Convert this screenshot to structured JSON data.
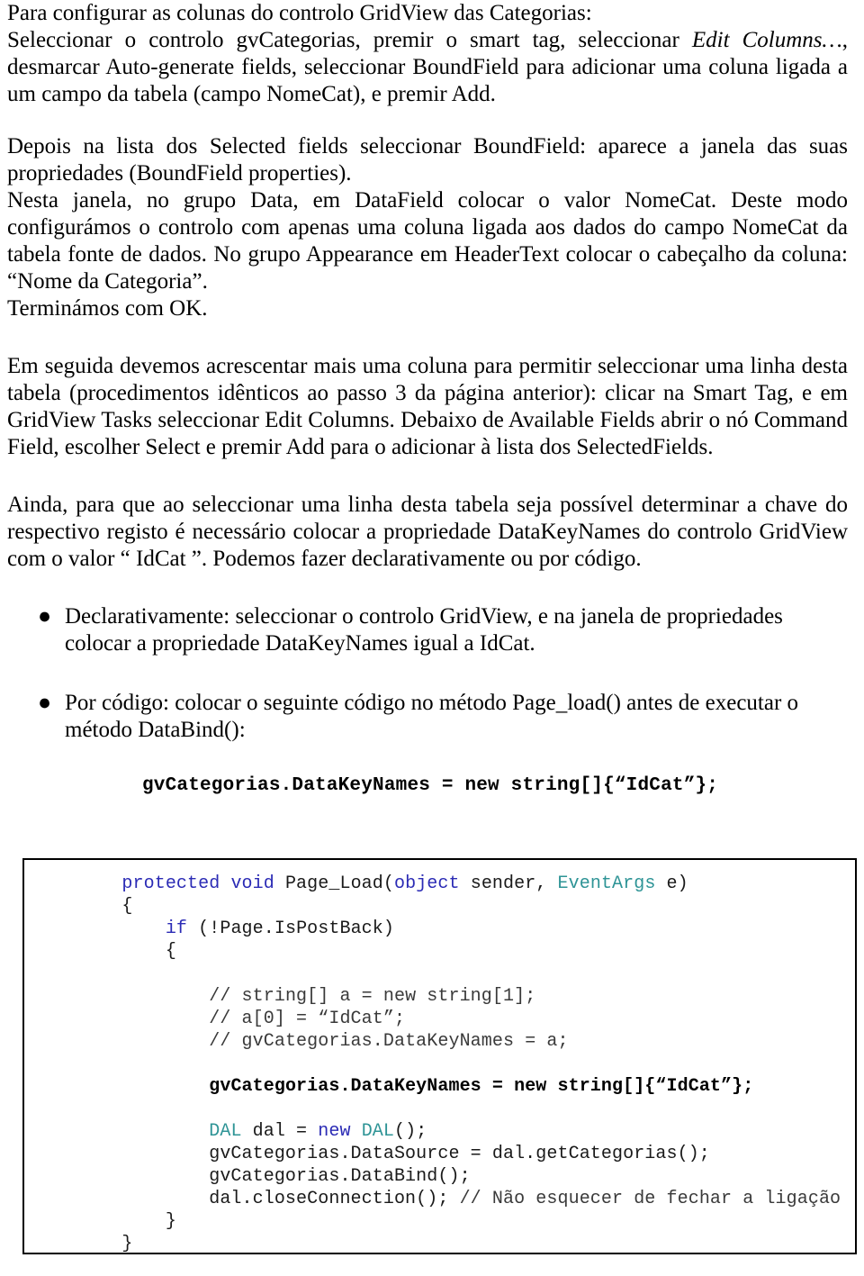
{
  "document": {
    "intro": {
      "line1": "Para configurar as colunas do controlo GridView das Categorias:",
      "line2_pre": "Seleccionar o controlo gvCategorias, premir o smart tag, seleccionar ",
      "line2_italic": "Edit Columns…",
      "line2_post": ", desmarcar Auto-generate fields, seleccionar BoundField para adicionar uma coluna ligada a um campo da tabela (campo NomeCat), e premir Add."
    },
    "paragraphs": {
      "p1": "Depois na lista dos Selected fields seleccionar BoundField: aparece a janela das suas propriedades (BoundField properties).",
      "p2": "Nesta janela, no grupo Data, em DataField colocar o valor NomeCat. Deste modo configurámos o controlo com apenas uma coluna ligada aos dados do campo NomeCat da tabela fonte de dados. No grupo Appearance em HeaderText colocar o cabeçalho da coluna: “Nome da Categoria”.",
      "p3": "Terminámos com OK.",
      "p4": "Em seguida devemos acrescentar mais uma coluna para permitir seleccionar uma linha desta tabela (procedimentos idênticos ao passo 3 da página anterior): clicar na Smart Tag, e em GridView Tasks seleccionar Edit Columns. Debaixo de Available Fields abrir o nó Command Field, escolher Select e premir Add para o adicionar à lista dos SelectedFields.",
      "p5": "Ainda, para que ao seleccionar uma linha desta tabela seja possível determinar a chave do respectivo registo é necessário colocar a propriedade DataKeyNames do controlo GridView com o valor “ IdCat ”. Podemos fazer declarativamente ou por código."
    },
    "bullets": [
      {
        "marker": "●",
        "text": "Declarativamente: seleccionar o controlo GridView, e na janela de propriedades colocar a propriedade DataKeyNames igual a IdCat."
      },
      {
        "marker": "●",
        "text": "Por código: colocar o seguinte código no método Page_load() antes de executar o método DataBind():"
      }
    ],
    "code_snippet_line": "gvCategorias.DataKeyNames = new string[]{“IdCat”};",
    "code_block": {
      "lines": [
        {
          "segments": [
            {
              "t": "    ",
              "c": ""
            },
            {
              "t": "protected void ",
              "c": "kw"
            },
            {
              "t": "Page_Load(",
              "c": ""
            },
            {
              "t": "object",
              "c": "kw"
            },
            {
              "t": " sender, ",
              "c": ""
            },
            {
              "t": "EventArgs",
              "c": "typ"
            },
            {
              "t": " e)",
              "c": ""
            }
          ]
        },
        {
          "segments": [
            {
              "t": "    {",
              "c": ""
            }
          ]
        },
        {
          "segments": [
            {
              "t": "        ",
              "c": ""
            },
            {
              "t": "if",
              "c": "kw"
            },
            {
              "t": " (!Page.IsPostBack)",
              "c": ""
            }
          ]
        },
        {
          "segments": [
            {
              "t": "        {",
              "c": ""
            }
          ]
        },
        {
          "segments": [
            {
              "t": "",
              "c": ""
            }
          ]
        },
        {
          "segments": [
            {
              "t": "            ",
              "c": ""
            },
            {
              "t": "// string[] a = new string[1];",
              "c": "cmt"
            }
          ]
        },
        {
          "segments": [
            {
              "t": "            ",
              "c": ""
            },
            {
              "t": "// a[0] = “IdCat”;",
              "c": "cmt"
            }
          ]
        },
        {
          "segments": [
            {
              "t": "            ",
              "c": ""
            },
            {
              "t": "// gvCategorias.DataKeyNames = a;",
              "c": "cmt"
            }
          ]
        },
        {
          "segments": [
            {
              "t": "",
              "c": ""
            }
          ]
        },
        {
          "segments": [
            {
              "t": "            ",
              "c": ""
            },
            {
              "t": "gvCategorias.DataKeyNames = new string[]{“IdCat”};",
              "c": "bld"
            }
          ]
        },
        {
          "segments": [
            {
              "t": "",
              "c": ""
            }
          ]
        },
        {
          "segments": [
            {
              "t": "            ",
              "c": ""
            },
            {
              "t": "DAL",
              "c": "typ"
            },
            {
              "t": " dal = ",
              "c": ""
            },
            {
              "t": "new",
              "c": "kw"
            },
            {
              "t": " ",
              "c": ""
            },
            {
              "t": "DAL",
              "c": "typ"
            },
            {
              "t": "();",
              "c": ""
            }
          ]
        },
        {
          "segments": [
            {
              "t": "            gvCategorias.DataSource = dal.getCategorias();",
              "c": ""
            }
          ]
        },
        {
          "segments": [
            {
              "t": "            gvCategorias.DataBind();",
              "c": ""
            }
          ]
        },
        {
          "segments": [
            {
              "t": "            dal.closeConnection(); ",
              "c": ""
            },
            {
              "t": "// Não esquecer de fechar a ligação",
              "c": "cmt"
            }
          ]
        },
        {
          "segments": [
            {
              "t": "        }",
              "c": ""
            }
          ]
        },
        {
          "segments": [
            {
              "t": "    }",
              "c": ""
            }
          ]
        }
      ]
    },
    "colors": {
      "keyword": "#2b2bb5",
      "type": "#2e9496",
      "comment": "#3a3a3a",
      "text": "#000000",
      "border": "#000000",
      "background": "#ffffff"
    }
  }
}
